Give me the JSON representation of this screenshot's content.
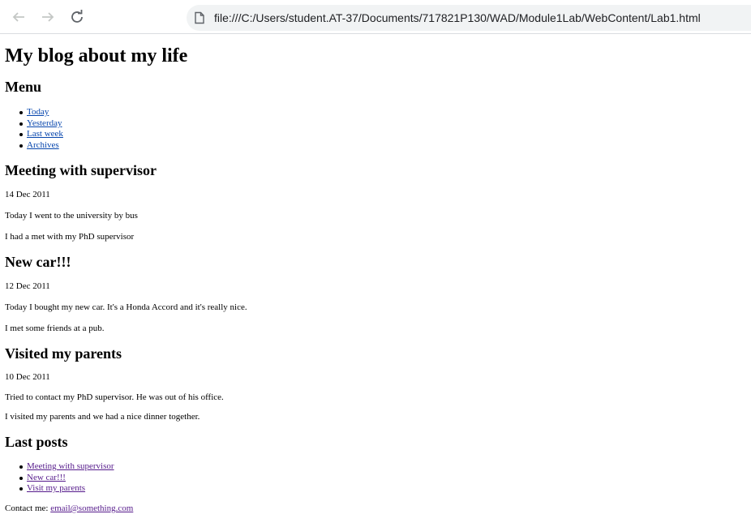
{
  "browser": {
    "address": "file:///C:/Users/student.AT-37/Documents/717821P130/WAD/Module1Lab/WebContent/Lab1.html"
  },
  "page": {
    "title": "My blog about my life",
    "menu_heading": "Menu",
    "menu": [
      "Today",
      "Yesterday",
      "Last week",
      "Archives"
    ],
    "posts": [
      {
        "title": "Meeting with supervisor",
        "date": "14 Dec 2011",
        "paragraphs": [
          "Today I went to the university by bus",
          "I had a met with my PhD supervisor"
        ]
      },
      {
        "title": "New car!!!",
        "date": "12 Dec 2011",
        "paragraphs": [
          "Today I bought my new car. It's a Honda Accord and it's really nice.",
          "I met some friends at a pub."
        ]
      },
      {
        "title": "Visited my parents",
        "date": "10 Dec 2011",
        "paragraphs": [
          "Tried to contact my PhD supervisor. He was out of his office.",
          "I visited my parents and we had a nice dinner together."
        ]
      }
    ],
    "last_posts_heading": "Last posts",
    "last_posts": [
      "Meeting with supervisor",
      "New car!!!",
      "Visit my parents"
    ],
    "contact_label": "Contact me:",
    "contact_email": "email@something.com"
  },
  "colors": {
    "link": "#0645ad",
    "visited_link": "#551a8b"
  }
}
